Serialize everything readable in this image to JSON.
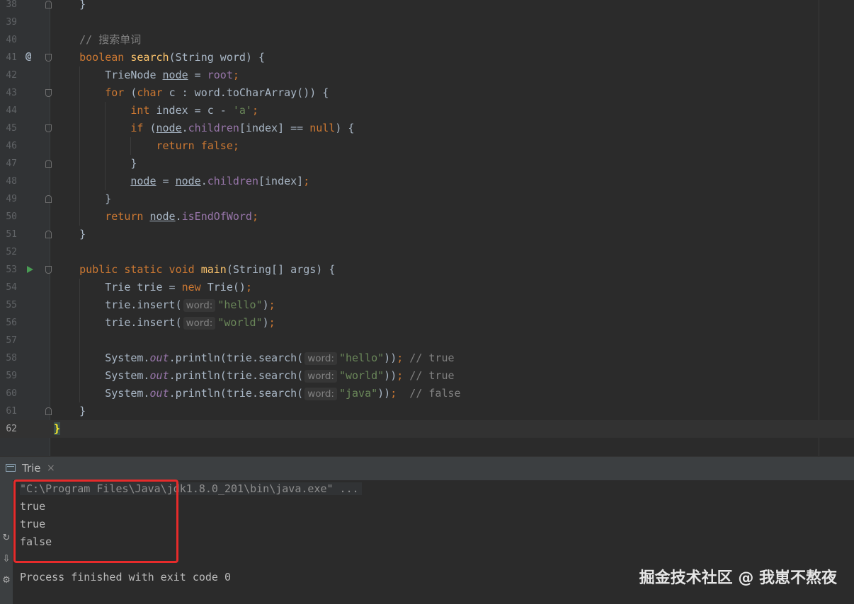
{
  "editor": {
    "lines": [
      {
        "num": "38",
        "segs": [
          {
            "t": "    }"
          }
        ]
      },
      {
        "num": "39",
        "segs": []
      },
      {
        "num": "40",
        "segs": [
          {
            "t": "    // 搜索单词",
            "c": "cmt"
          }
        ]
      },
      {
        "num": "41",
        "segs": [
          {
            "t": "    "
          },
          {
            "t": "boolean ",
            "c": "kw"
          },
          {
            "t": "search",
            "c": "fn"
          },
          {
            "t": "(String word) {"
          }
        ]
      },
      {
        "num": "42",
        "segs": [
          {
            "t": "        TrieNode "
          },
          {
            "t": "node",
            "c": "ul"
          },
          {
            "t": " = "
          },
          {
            "t": "root",
            "c": "fld"
          },
          {
            "t": ";",
            "c": "kw"
          }
        ]
      },
      {
        "num": "43",
        "segs": [
          {
            "t": "        "
          },
          {
            "t": "for ",
            "c": "kw"
          },
          {
            "t": "("
          },
          {
            "t": "char ",
            "c": "kw"
          },
          {
            "t": "c : word.toCharArray()) {"
          }
        ]
      },
      {
        "num": "44",
        "segs": [
          {
            "t": "            "
          },
          {
            "t": "int ",
            "c": "kw"
          },
          {
            "t": "index = c - "
          },
          {
            "t": "'a'",
            "c": "str"
          },
          {
            "t": ";",
            "c": "kw"
          }
        ]
      },
      {
        "num": "45",
        "segs": [
          {
            "t": "            "
          },
          {
            "t": "if ",
            "c": "kw"
          },
          {
            "t": "("
          },
          {
            "t": "node",
            "c": "ul"
          },
          {
            "t": "."
          },
          {
            "t": "children",
            "c": "fld"
          },
          {
            "t": "[index] == "
          },
          {
            "t": "null",
            "c": "kw"
          },
          {
            "t": ") {"
          }
        ]
      },
      {
        "num": "46",
        "segs": [
          {
            "t": "                "
          },
          {
            "t": "return false;",
            "c": "kw"
          }
        ]
      },
      {
        "num": "47",
        "segs": [
          {
            "t": "            }"
          }
        ]
      },
      {
        "num": "48",
        "segs": [
          {
            "t": "            "
          },
          {
            "t": "node",
            "c": "ul"
          },
          {
            "t": " = "
          },
          {
            "t": "node",
            "c": "ul"
          },
          {
            "t": "."
          },
          {
            "t": "children",
            "c": "fld"
          },
          {
            "t": "[index]"
          },
          {
            "t": ";",
            "c": "kw"
          }
        ]
      },
      {
        "num": "49",
        "segs": [
          {
            "t": "        }"
          }
        ]
      },
      {
        "num": "50",
        "segs": [
          {
            "t": "        "
          },
          {
            "t": "return ",
            "c": "kw"
          },
          {
            "t": "node",
            "c": "ul"
          },
          {
            "t": "."
          },
          {
            "t": "isEndOfWord",
            "c": "fld"
          },
          {
            "t": ";",
            "c": "kw"
          }
        ]
      },
      {
        "num": "51",
        "segs": [
          {
            "t": "    }"
          }
        ]
      },
      {
        "num": "52",
        "segs": []
      },
      {
        "num": "53",
        "segs": [
          {
            "t": "    "
          },
          {
            "t": "public static void ",
            "c": "kw"
          },
          {
            "t": "main",
            "c": "fn"
          },
          {
            "t": "(String[] args) {"
          }
        ]
      },
      {
        "num": "54",
        "segs": [
          {
            "t": "        Trie trie = "
          },
          {
            "t": "new ",
            "c": "kw"
          },
          {
            "t": "Trie()"
          },
          {
            "t": ";",
            "c": "kw"
          }
        ]
      },
      {
        "num": "55",
        "segs": [
          {
            "t": "        trie.insert("
          },
          {
            "t": "word:",
            "c": "hint"
          },
          {
            "t": "\"hello\"",
            "c": "str"
          },
          {
            "t": ")"
          },
          {
            "t": ";",
            "c": "kw"
          }
        ]
      },
      {
        "num": "56",
        "segs": [
          {
            "t": "        trie.insert("
          },
          {
            "t": "word:",
            "c": "hint"
          },
          {
            "t": "\"world\"",
            "c": "str"
          },
          {
            "t": ")"
          },
          {
            "t": ";",
            "c": "kw"
          }
        ]
      },
      {
        "num": "57",
        "segs": []
      },
      {
        "num": "58",
        "segs": [
          {
            "t": "        System."
          },
          {
            "t": "out",
            "c": "ital"
          },
          {
            "t": ".println(trie.search("
          },
          {
            "t": "word:",
            "c": "hint"
          },
          {
            "t": "\"hello\"",
            "c": "str"
          },
          {
            "t": "))"
          },
          {
            "t": "; ",
            "c": "kw"
          },
          {
            "t": "// true",
            "c": "cmt"
          }
        ]
      },
      {
        "num": "59",
        "segs": [
          {
            "t": "        System."
          },
          {
            "t": "out",
            "c": "ital"
          },
          {
            "t": ".println(trie.search("
          },
          {
            "t": "word:",
            "c": "hint"
          },
          {
            "t": "\"world\"",
            "c": "str"
          },
          {
            "t": "))"
          },
          {
            "t": "; ",
            "c": "kw"
          },
          {
            "t": "// true",
            "c": "cmt"
          }
        ]
      },
      {
        "num": "60",
        "segs": [
          {
            "t": "        System."
          },
          {
            "t": "out",
            "c": "ital"
          },
          {
            "t": ".println(trie.search("
          },
          {
            "t": "word:",
            "c": "hint"
          },
          {
            "t": "\"java\"",
            "c": "str"
          },
          {
            "t": "))"
          },
          {
            "t": ";  ",
            "c": "kw"
          },
          {
            "t": "// false",
            "c": "cmt"
          }
        ]
      },
      {
        "num": "61",
        "segs": [
          {
            "t": "    }"
          }
        ]
      },
      {
        "num": "62",
        "segs": [
          {
            "t": "}",
            "c": "brace-hl"
          }
        ],
        "current": true
      }
    ]
  },
  "run_panel": {
    "tab_title": "Trie",
    "tab_close": "×",
    "command": "\"C:\\Program Files\\Java\\jdk1.8.0_201\\bin\\java.exe\" ...",
    "output": [
      "true",
      "true",
      "false"
    ],
    "exit_message": "Process finished with exit code 0"
  },
  "gutter_icons": {
    "override": "@",
    "run": "run-icon"
  },
  "watermark": "掘金技术社区 @ 我崽不熬夜",
  "colors": {
    "keyword": "#cc7832",
    "function": "#ffc66d",
    "string": "#6a8759",
    "comment": "#808080",
    "field": "#9876aa",
    "highlight_box": "#e62b2b"
  }
}
